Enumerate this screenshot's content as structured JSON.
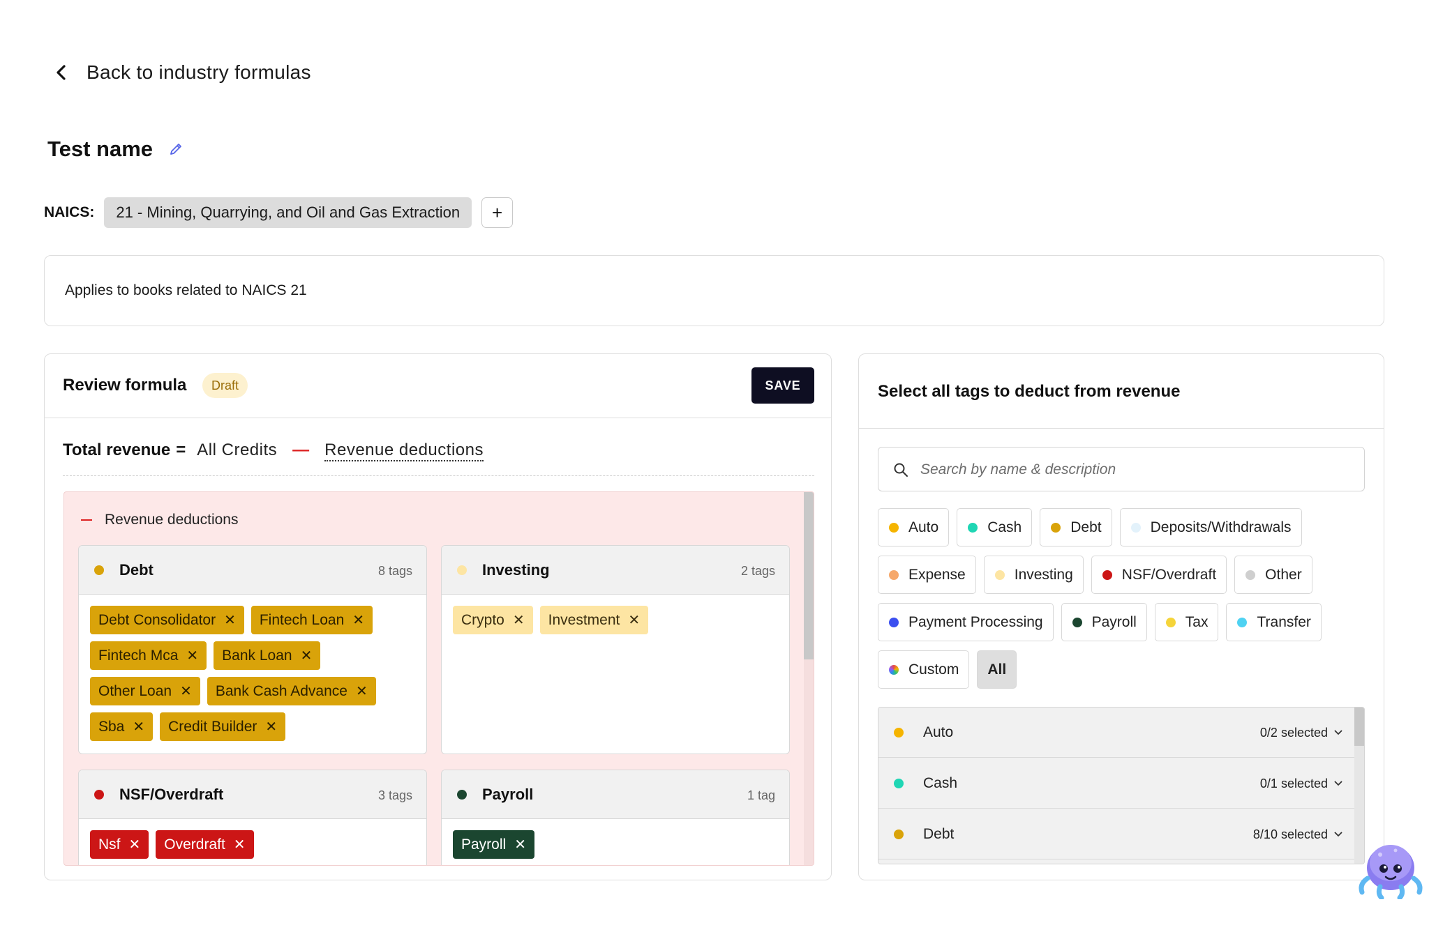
{
  "nav": {
    "back_label": "Back to industry formulas"
  },
  "formula": {
    "name": "Test name"
  },
  "naics": {
    "label": "NAICS:",
    "chip": "21 - Mining, Quarrying, and Oil and Gas Extraction",
    "add_symbol": "+"
  },
  "description": "Applies to books related to NAICS 21",
  "review": {
    "title": "Review formula",
    "status": "Draft",
    "save_label": "SAVE",
    "formula_label": "Total revenue",
    "equals": "=",
    "credits": "All Credits",
    "minus": "—",
    "deductions_link": "Revenue deductions",
    "deductions_heading": "Revenue deductions",
    "categories": [
      {
        "name": "Debt",
        "count": "8 tags",
        "color": "#d9a30a",
        "tags": [
          "Debt Consolidator",
          "Fintech Loan",
          "Fintech Mca",
          "Bank Loan",
          "Other Loan",
          "Bank Cash Advance",
          "Sba",
          "Credit Builder"
        ]
      },
      {
        "name": "Investing",
        "count": "2 tags",
        "color": "#fde5a3",
        "tags": [
          "Crypto",
          "Investment"
        ]
      },
      {
        "name": "NSF/Overdraft",
        "count": "3 tags",
        "color": "#cc1616",
        "tags": [
          "Nsf",
          "Overdraft"
        ]
      },
      {
        "name": "Payroll",
        "count": "1 tag",
        "color": "#1b4630",
        "tags": [
          "Payroll"
        ]
      }
    ]
  },
  "tag_selector": {
    "title": "Select all tags to deduct from revenue",
    "search_placeholder": "Search by name & description",
    "filters": [
      {
        "label": "Auto",
        "color": "#f5b400"
      },
      {
        "label": "Cash",
        "color": "#1fd6b4"
      },
      {
        "label": "Debt",
        "color": "#d9a30a"
      },
      {
        "label": "Deposits/Withdrawals",
        "color": "#e3f2fb"
      },
      {
        "label": "Expense",
        "color": "#f6a86b"
      },
      {
        "label": "Investing",
        "color": "#fde5a3"
      },
      {
        "label": "NSF/Overdraft",
        "color": "#cc1616"
      },
      {
        "label": "Other",
        "color": "#cfcfcf"
      },
      {
        "label": "Payment Processing",
        "color": "#3b4ff0"
      },
      {
        "label": "Payroll",
        "color": "#1b4630"
      },
      {
        "label": "Tax",
        "color": "#f5d43a"
      },
      {
        "label": "Transfer",
        "color": "#4fd2f2"
      },
      {
        "label": "Custom",
        "color": "rainbow"
      }
    ],
    "all_label": "All",
    "groups": [
      {
        "name": "Auto",
        "selected": "0/2 selected",
        "color": "#f5b400"
      },
      {
        "name": "Cash",
        "selected": "0/1 selected",
        "color": "#1fd6b4"
      },
      {
        "name": "Debt",
        "selected": "8/10 selected",
        "color": "#d9a30a"
      }
    ]
  }
}
